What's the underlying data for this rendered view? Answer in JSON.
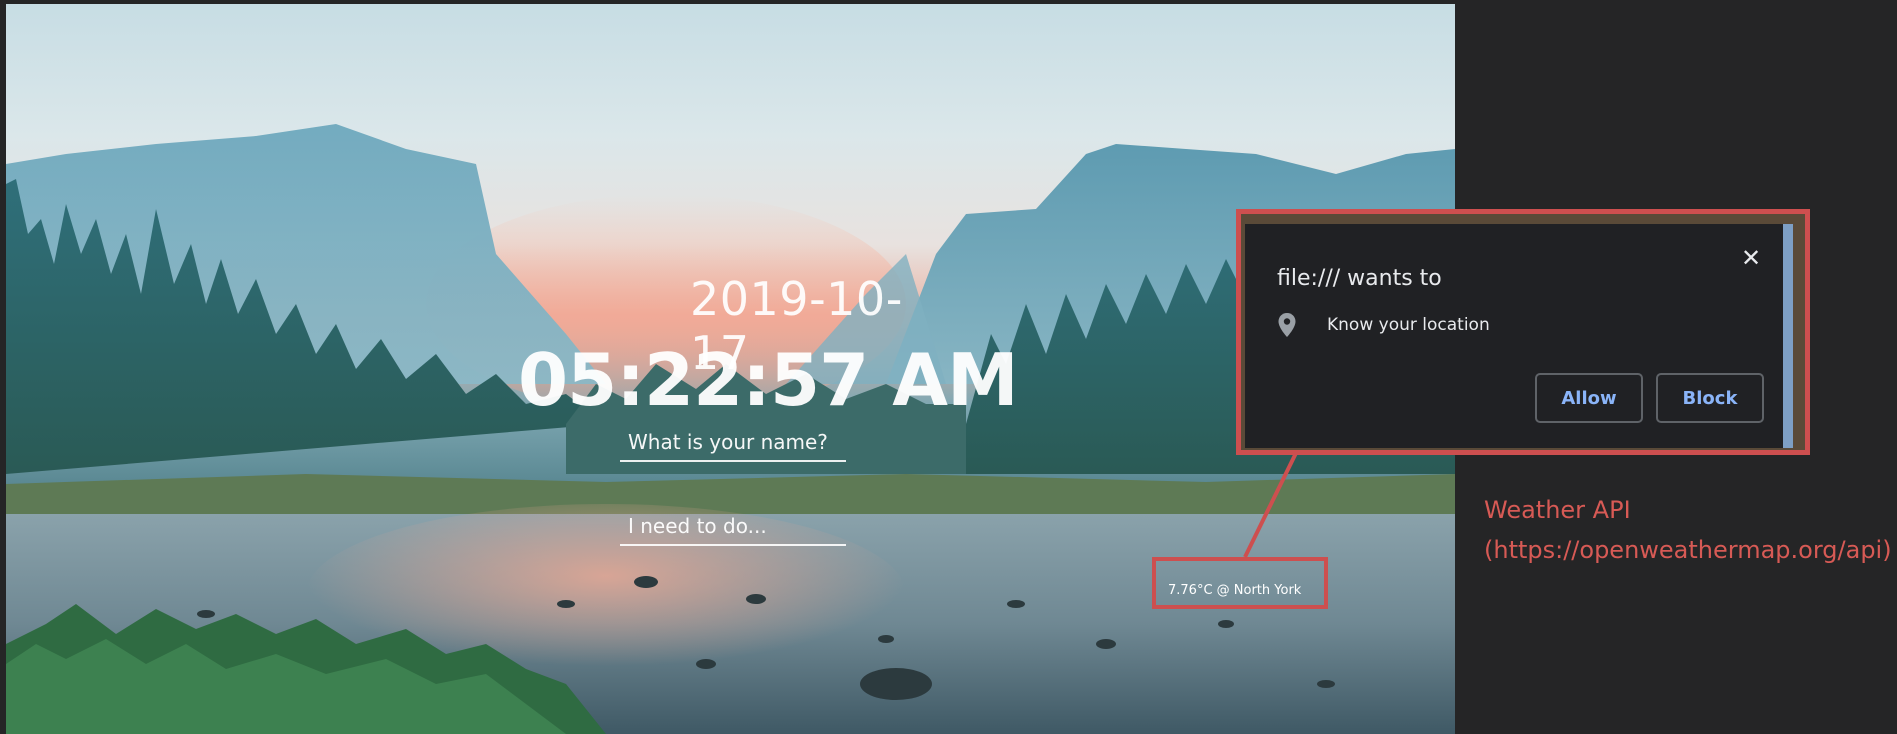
{
  "clock": {
    "date": "2019-10-17",
    "time": "05:22:57 AM"
  },
  "inputs": {
    "name_placeholder": "What is your name?",
    "todo_placeholder": "I need to do..."
  },
  "weather": {
    "text": "7.76°C @ North York"
  },
  "permission_popup": {
    "title": "file:/// wants to",
    "permission": "Know your location",
    "allow_label": "Allow",
    "block_label": "Block",
    "close_icon": "close-icon",
    "location_icon": "location-pin-icon"
  },
  "annotation": {
    "line1": "Weather API",
    "line2": "(https://openweathermap.org/api)",
    "color": "#cd4f4f"
  }
}
